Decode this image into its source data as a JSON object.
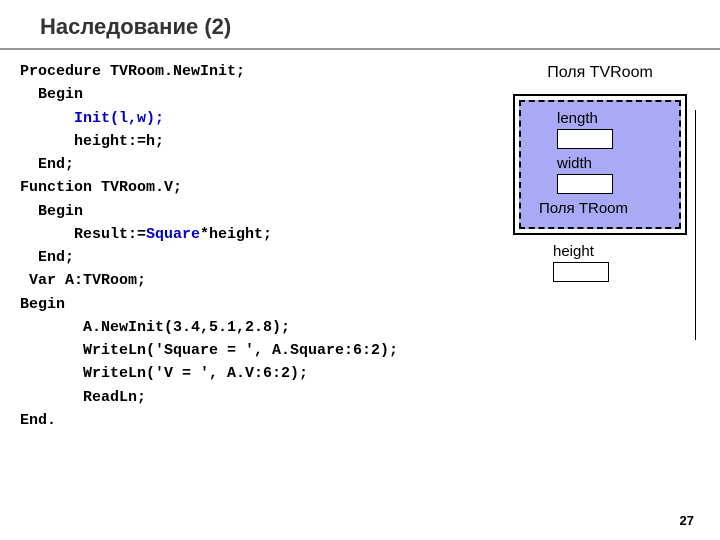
{
  "title": "Наследование (2)",
  "code": {
    "l1": "Procedure TVRoom.NewInit;",
    "l2": "  Begin",
    "l3a": "      ",
    "l3b": "Init(l,w);",
    "l4": "      height:=h;",
    "l5": "  End;",
    "l6": "Function TVRoom.V;",
    "l7": "  Begin",
    "l8a": "      Result:=",
    "l8b": "Square",
    "l8c": "*height;",
    "l9": "  End;",
    "l10": " Var A:TVRoom;",
    "l11": "Begin",
    "l12": "       A.NewInit(3.4,5.1,2.8);",
    "l13": "       WriteLn('Square = ', A.Square:6:2);",
    "l14": "       WriteLn('V = ', A.V:6:2);",
    "l15": "       ReadLn;",
    "l16": "End."
  },
  "diagram": {
    "title": "Поля TVRoom",
    "field1": "length",
    "field2": "width",
    "troom": "Поля TRoom",
    "height": "height"
  },
  "page": "27"
}
